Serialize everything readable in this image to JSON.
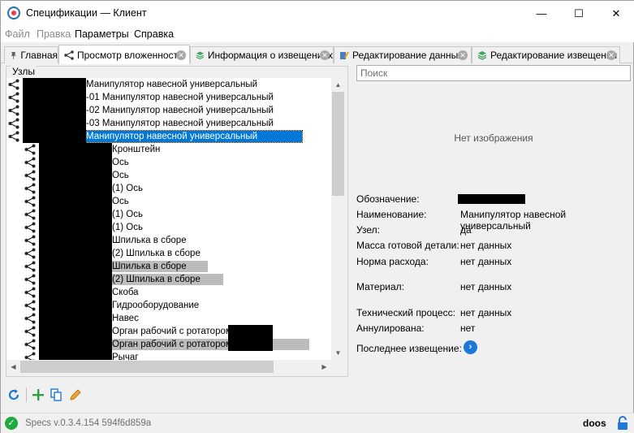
{
  "window": {
    "title": "Спецификации — Клиент",
    "min_glyph": "—",
    "max_glyph": "☐",
    "close_glyph": "✕"
  },
  "menu": [
    {
      "label": "Файл",
      "enabled": false
    },
    {
      "label": "Правка",
      "enabled": false
    },
    {
      "label": "Параметры",
      "enabled": true
    },
    {
      "label": "Справка",
      "enabled": true
    }
  ],
  "tabs": [
    {
      "label": "Главная",
      "icon": "pin-icon",
      "closable": false,
      "active": false
    },
    {
      "label": "Просмотр вложенности",
      "icon": "hierarchy-icon",
      "closable": true,
      "active": true
    },
    {
      "label": "Информация о извещениях",
      "icon": "stack-icon",
      "closable": true,
      "active": false
    },
    {
      "label": "Редактирование данных",
      "icon": "edit-data-icon",
      "closable": true,
      "active": false
    },
    {
      "label": "Редактирование извещения",
      "icon": "stack-icon",
      "closable": true,
      "active": false
    }
  ],
  "tree": {
    "caption": "Узлы",
    "rows": [
      {
        "label": "Манипулятор навесной универсальный",
        "level": 0,
        "state": "normal"
      },
      {
        "label": "-01 Манипулятор навесной универсальный",
        "level": 0,
        "state": "normal"
      },
      {
        "label": "-02 Манипулятор навесной универсальный",
        "level": 0,
        "state": "normal"
      },
      {
        "label": "-03 Манипулятор навесной универсальный",
        "level": 0,
        "state": "normal"
      },
      {
        "label": "Манипулятор навесной универсальный",
        "level": 0,
        "state": "selected"
      },
      {
        "label": "Кронштейн",
        "level": 1,
        "state": "normal"
      },
      {
        "label": "Ось",
        "level": 1,
        "state": "normal"
      },
      {
        "label": "Ось",
        "level": 1,
        "state": "normal"
      },
      {
        "label": "(1) Ось",
        "level": 1,
        "state": "normal"
      },
      {
        "label": "Ось",
        "level": 1,
        "state": "normal"
      },
      {
        "label": "(1) Ось",
        "level": 1,
        "state": "normal"
      },
      {
        "label": "(1) Ось",
        "level": 1,
        "state": "normal"
      },
      {
        "label": "Шпилька в сборе",
        "level": 1,
        "state": "normal"
      },
      {
        "label": "(2) Шпилька в сборе",
        "level": 1,
        "state": "normal"
      },
      {
        "label": "Шпилька в сборе",
        "level": 1,
        "state": "grey"
      },
      {
        "label": "(2) Шпилька в сборе",
        "level": 1,
        "state": "grey"
      },
      {
        "label": "Скоба",
        "level": 1,
        "state": "normal"
      },
      {
        "label": "Гидрооборудование",
        "level": 1,
        "state": "normal"
      },
      {
        "label": "Навес",
        "level": 1,
        "state": "normal"
      },
      {
        "label": "Орган рабочий с ротатором",
        "level": 1,
        "state": "normal-redacted-tail"
      },
      {
        "label": "Орган рабочий с ротатором",
        "level": 1,
        "state": "grey-redacted-tail"
      },
      {
        "label": "Рычаг",
        "level": 1,
        "state": "normal"
      }
    ]
  },
  "search": {
    "placeholder": "Поиск"
  },
  "details": {
    "no_image": "Нет изображения",
    "props": [
      {
        "label": "Обозначение:",
        "value": "",
        "redacted": true
      },
      {
        "label": "Наименование:",
        "value": "Манипулятор навесной универсальный"
      },
      {
        "label": "Узел:",
        "value": "да"
      },
      {
        "label": "Масса готовой детали:",
        "value": "нет данных"
      },
      {
        "label": "Норма расхода:",
        "value": "нет данных"
      },
      {
        "label": "Материал:",
        "value": "нет данных"
      },
      {
        "label": "Технический процесс:",
        "value": "нет данных"
      },
      {
        "label": "Аннулирована:",
        "value": "нет"
      },
      {
        "label": "Последнее извещение:",
        "value": ""
      }
    ],
    "go_glyph": "›"
  },
  "toolbar": [
    "refresh-icon",
    "add-icon",
    "copy-icon",
    "edit-icon"
  ],
  "status": {
    "version": "Specs v.0.3.4.154 594f6d859a",
    "user": "doos",
    "ok_glyph": "✓"
  },
  "colors": {
    "selection": "#0078d7",
    "grey_highlight": "#bcbcbc",
    "status_ok": "#1eaa3c",
    "accent_blue": "#1e78d7"
  }
}
